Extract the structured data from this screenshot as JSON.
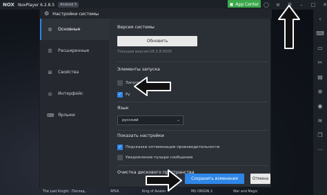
{
  "topbar": {
    "logo": "NOX",
    "title": "NoxPlayer 6.2.8.5",
    "badge": "Android 5",
    "app_center": "App Center"
  },
  "dialog": {
    "title": "Настройки системы",
    "nav": [
      {
        "label": "Основные",
        "icon": "gear-icon",
        "active": true
      },
      {
        "label": "Расширенные",
        "icon": "sliders-icon",
        "active": false
      },
      {
        "label": "Свойства",
        "icon": "grid-icon",
        "active": false
      },
      {
        "label": "Интерфейс",
        "icon": "eye-icon",
        "active": false
      },
      {
        "label": "Ярлыки",
        "icon": "keyboard-icon",
        "active": false
      }
    ],
    "version_section": {
      "title": "Версия системы",
      "update_label": "Обновить",
      "current": "Текущая версия:V6.2.8.5005"
    },
    "startup_section": {
      "title": "Элементы запуска",
      "items": [
        {
          "label": "Запускать при старте",
          "checked": false
        },
        {
          "label": "Ру",
          "checked": true
        }
      ]
    },
    "language_section": {
      "title": "Язык",
      "selected": "русский"
    },
    "display_section": {
      "title": "Показать настройки",
      "items": [
        {
          "label": "Подсказки оптимизации производительности",
          "checked": true
        },
        {
          "label": "Уведомление пузыри сообщения",
          "checked": false
        }
      ]
    },
    "disk_section": {
      "title": "Очистка дискового пространства"
    },
    "save_label": "Сохранить изменения",
    "cancel_label": "Отмена"
  },
  "apps": [
    "The Last Knight : Послед..",
    "AFKA",
    "King of Avalon",
    "MU ORIGIN 2",
    "War and Magic"
  ],
  "colors": {
    "accent": "#2e86e7",
    "app_center": "#3aa84a"
  }
}
